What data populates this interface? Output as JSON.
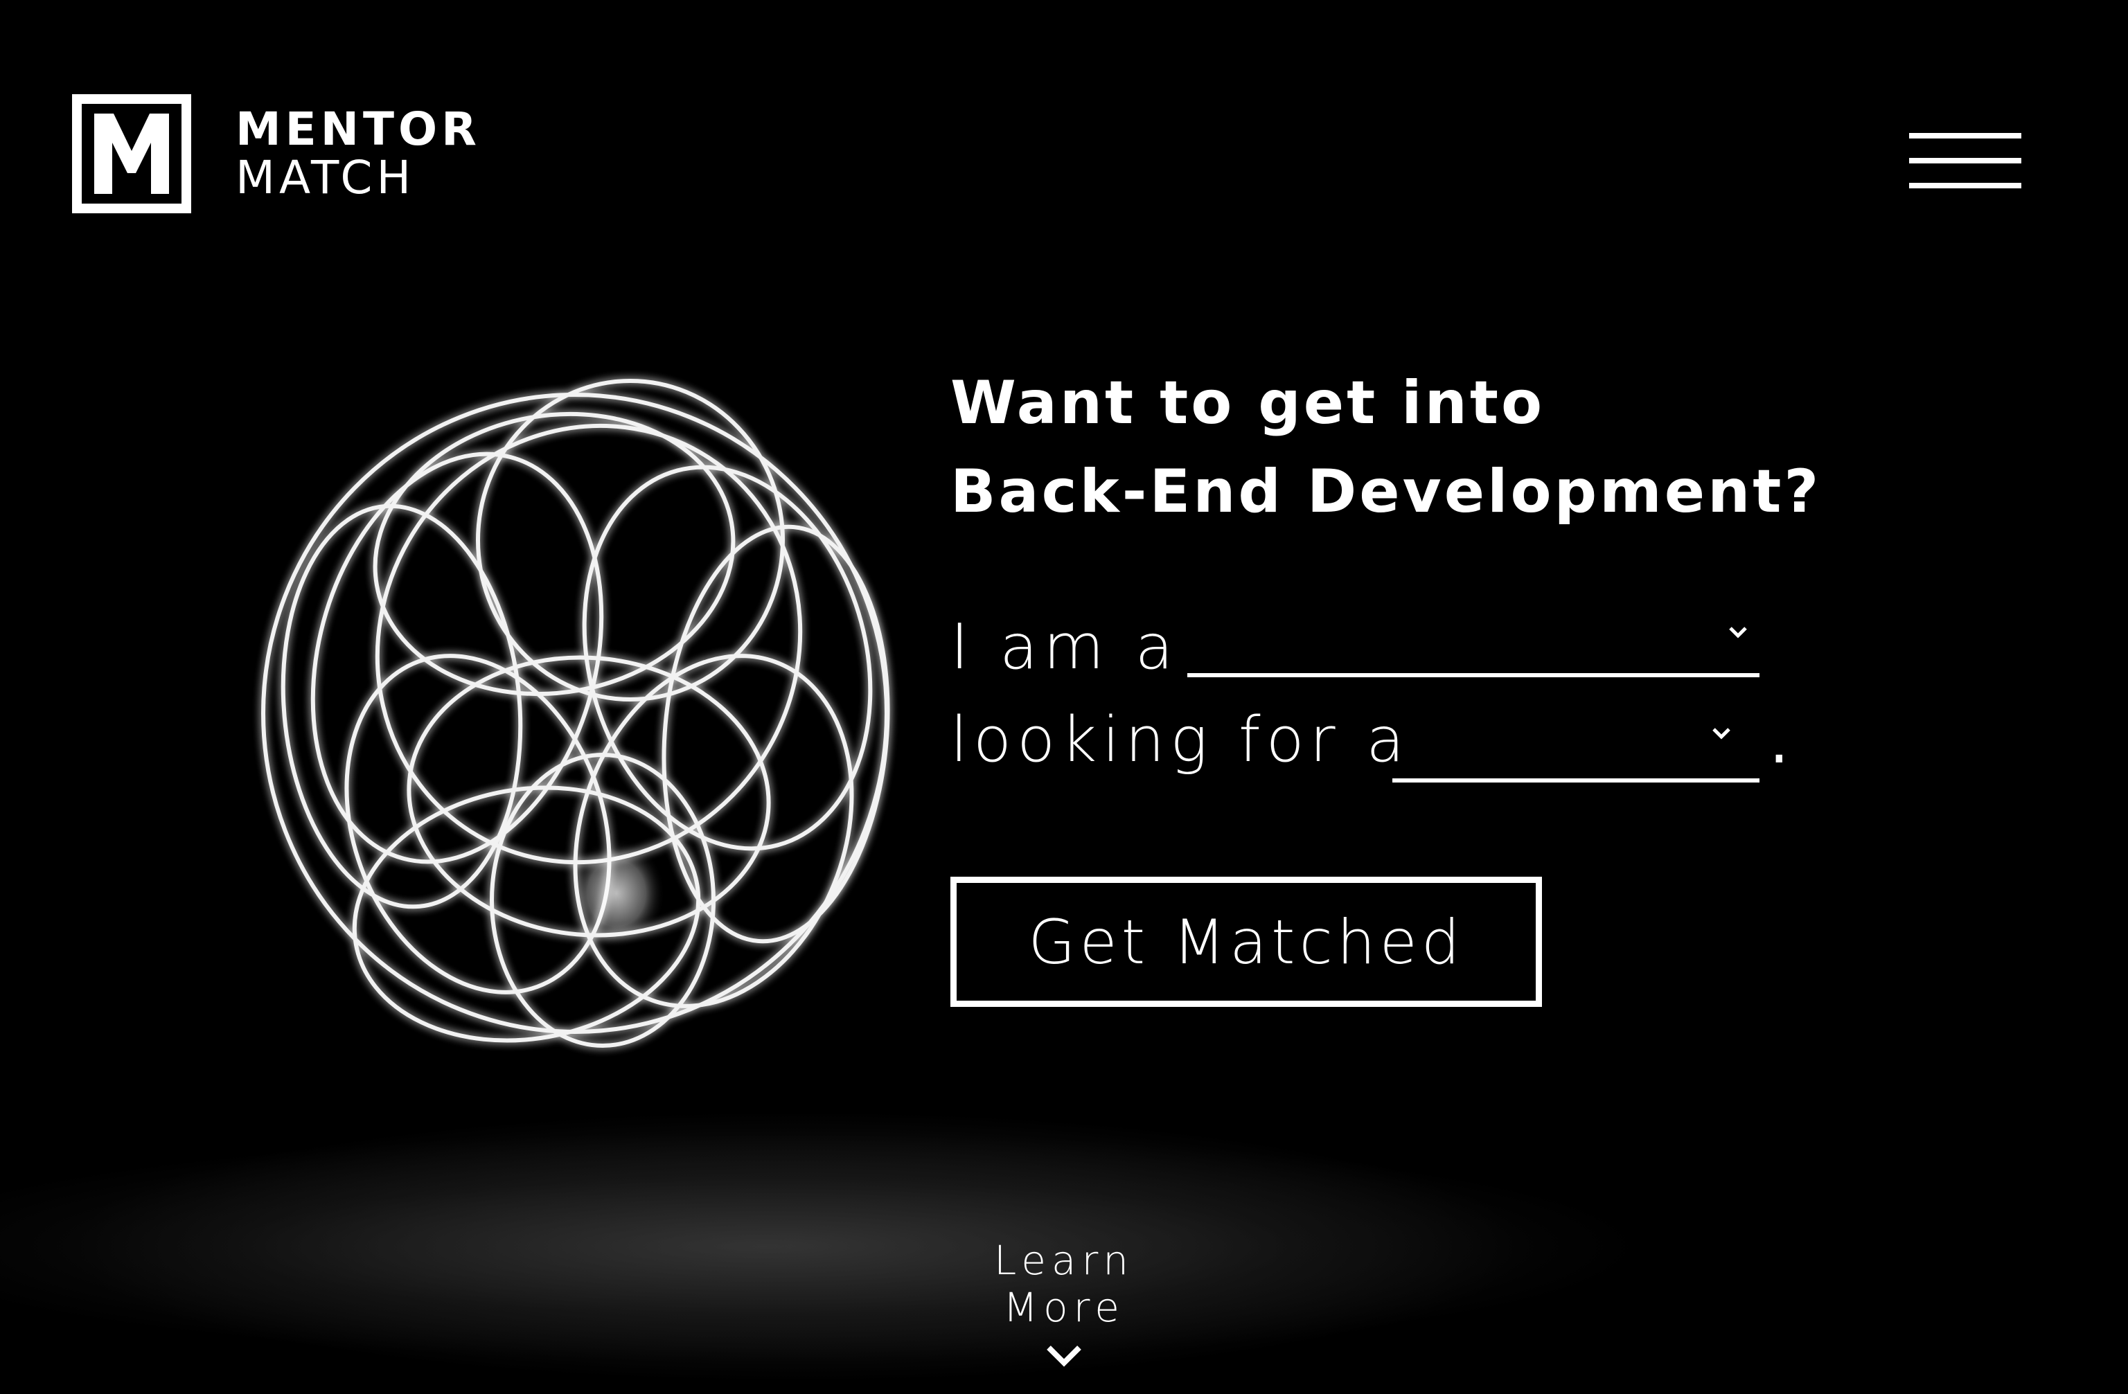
{
  "brand": {
    "logo_letter": "M",
    "name_line1": "MENTOR",
    "name_line2": "MATCH"
  },
  "nav": {
    "menu_icon": "hamburger-icon"
  },
  "hero": {
    "headline_line1": "Want to get into",
    "headline_line2": "Back-End Development?"
  },
  "form": {
    "role_prefix": "I am a",
    "role_value": "",
    "seeking_prefix": "looking for a",
    "seeking_value": "",
    "suffix": ".",
    "dropdown_icon": "chevron-down-icon",
    "submit_label": "Get Matched"
  },
  "footer_cta": {
    "label": "Learn More",
    "icon": "chevron-down-icon"
  },
  "colors": {
    "background": "#000000",
    "foreground": "#ffffff"
  }
}
